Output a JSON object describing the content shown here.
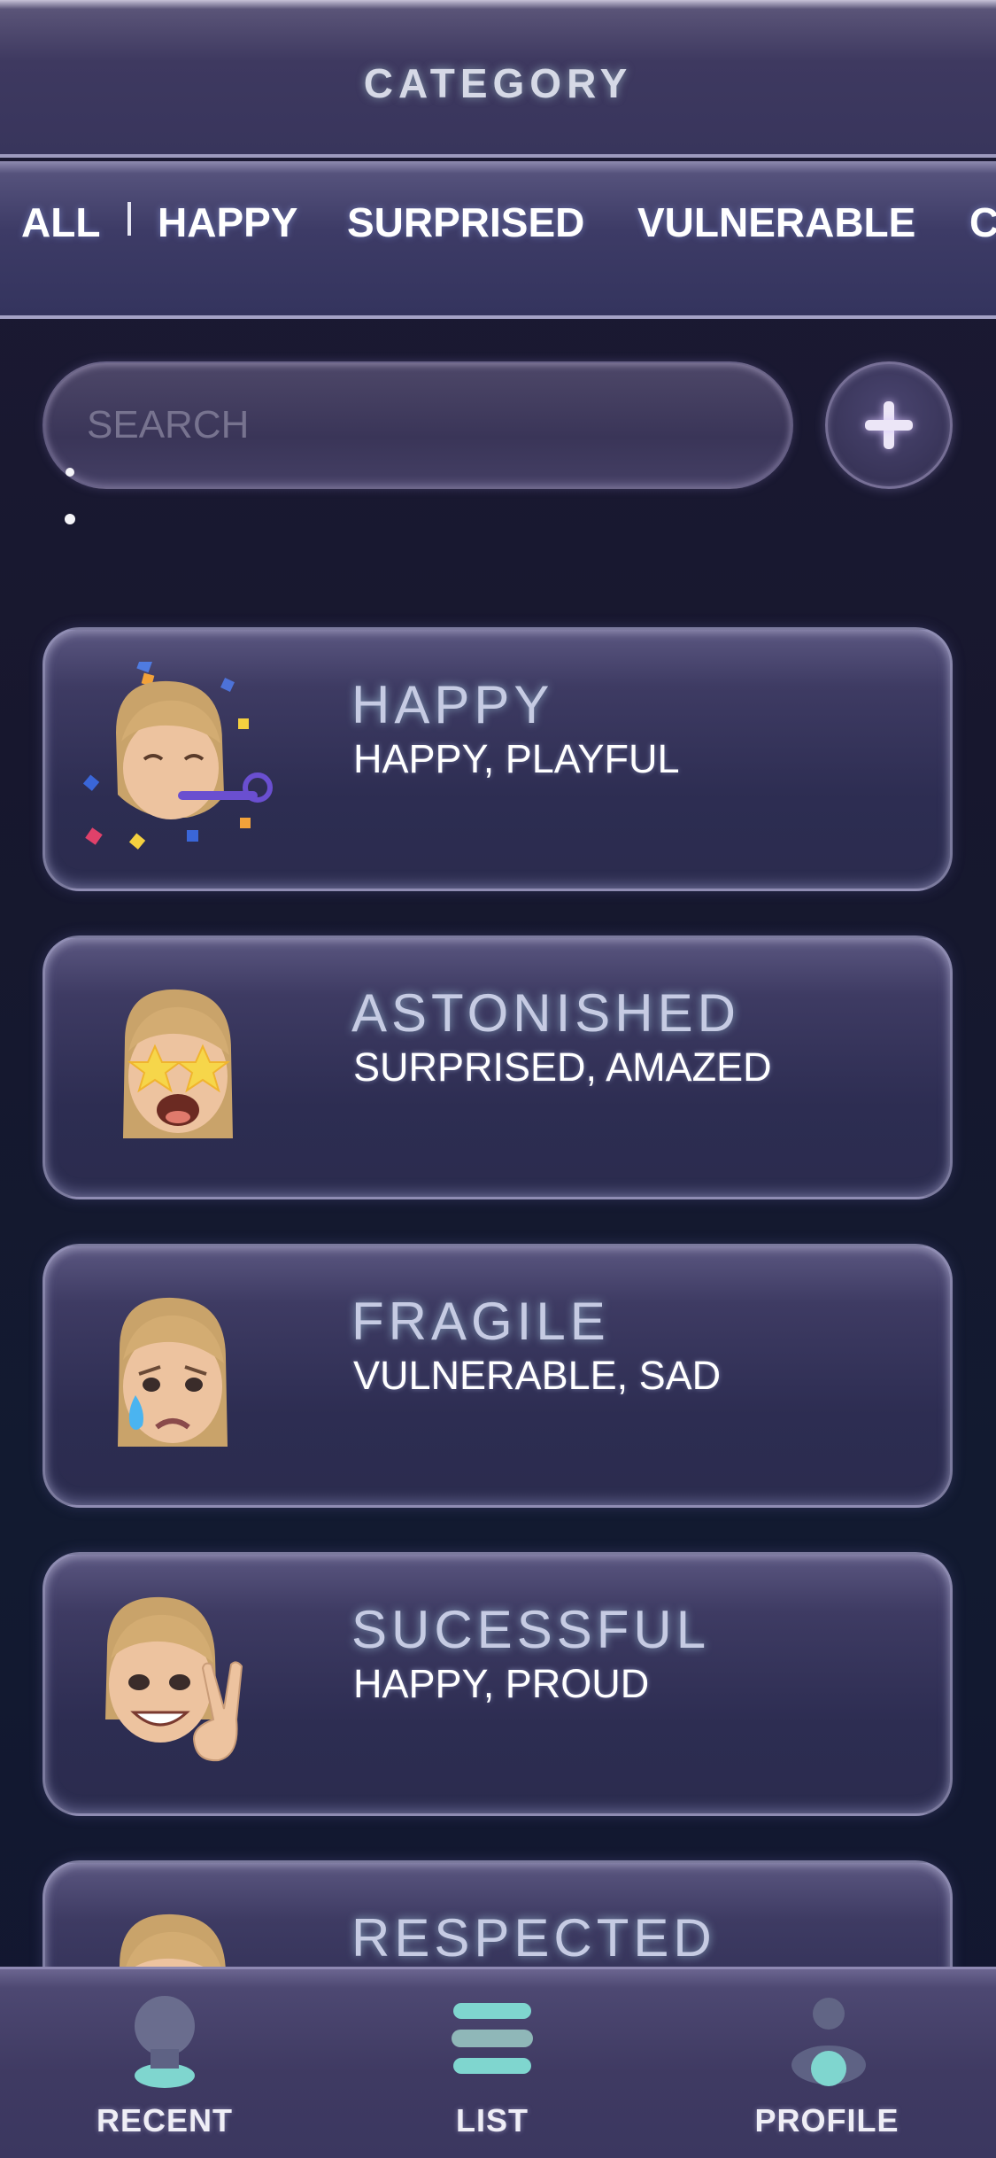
{
  "header": {
    "title": "CATEGORY"
  },
  "tabs": {
    "items": [
      {
        "label": "ALL"
      },
      {
        "label": "HAPPY"
      },
      {
        "label": "SURPRISED"
      },
      {
        "label": "VULNERABLE"
      },
      {
        "label": "C"
      }
    ]
  },
  "search": {
    "placeholder": "SEARCH",
    "value": ""
  },
  "add_button": {
    "icon": "plus-icon"
  },
  "cards": [
    {
      "title": "HAPPY",
      "subtitle": "HAPPY, PLAYFUL",
      "avatar": "party-memoji-icon"
    },
    {
      "title": "ASTONISHED",
      "subtitle": "SURPRISED, AMAZED",
      "avatar": "star-eyes-memoji-icon"
    },
    {
      "title": "FRAGILE",
      "subtitle": "VULNERABLE, SAD",
      "avatar": "crying-memoji-icon"
    },
    {
      "title": "SUCESSFUL",
      "subtitle": "HAPPY, PROUD",
      "avatar": "peace-sign-memoji-icon"
    },
    {
      "title": "RESPECTED",
      "subtitle": "",
      "avatar": "memoji-icon"
    }
  ],
  "bottom_nav": {
    "items": [
      {
        "label": "RECENT",
        "icon": "location-pin-icon"
      },
      {
        "label": "LIST",
        "icon": "list-icon"
      },
      {
        "label": "PROFILE",
        "icon": "user-icon"
      }
    ]
  },
  "colors": {
    "background": "#15152c",
    "header": "#3e3960",
    "card": "#2d2d52",
    "accent_teal": "#7fd6cf",
    "title_glow": "#c6cbe3"
  }
}
